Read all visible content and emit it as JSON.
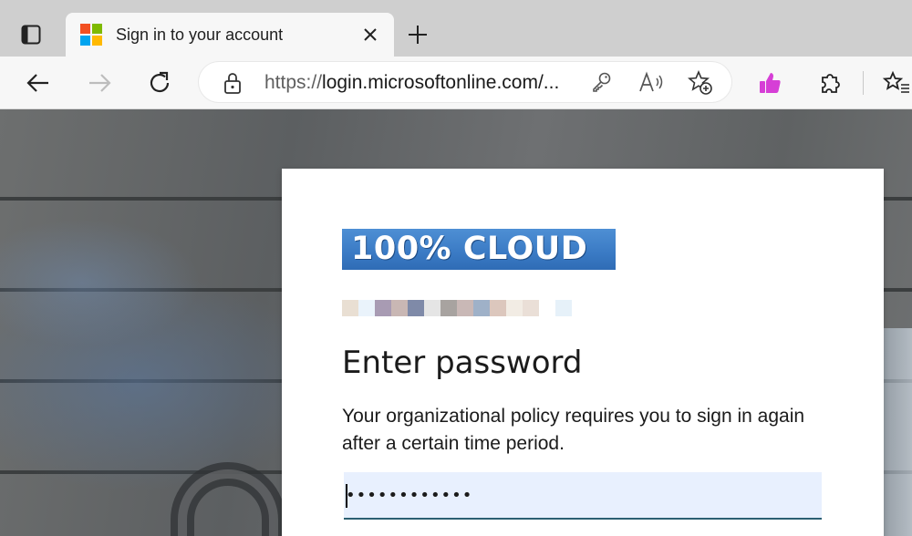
{
  "browser": {
    "tab": {
      "title": "Sign in to your account"
    },
    "address_bar": {
      "url_scheme": "https://",
      "url_rest": "login.microsoftonline.com/..."
    },
    "icons": {
      "tab_actions": "tab-actions-icon",
      "close": "close-icon",
      "new_tab": "plus-icon",
      "back": "back-arrow-icon",
      "forward": "forward-arrow-icon",
      "refresh": "refresh-icon",
      "lock": "lock-icon",
      "key": "key-icon",
      "read_aloud": "read-aloud-icon",
      "favorite_add": "add-favorite-icon",
      "thumbs_up": "thumbs-up-icon",
      "extensions": "puzzle-icon",
      "favorites": "favorites-icon"
    }
  },
  "signin": {
    "banner_text": "100% CLOUD",
    "heading": "Enter password",
    "description": "Your organizational policy requires you to sign in again after a certain time period.",
    "password_value": "••••••••••••"
  },
  "colors": {
    "tab_strip": "#cfcfcf",
    "toolbar": "#f7f7f7",
    "banner_blue": "#3a7ac4",
    "password_fill": "#e8f0fe",
    "input_underline": "#2b5f72",
    "thumbs_magenta": "#d63fd6"
  }
}
